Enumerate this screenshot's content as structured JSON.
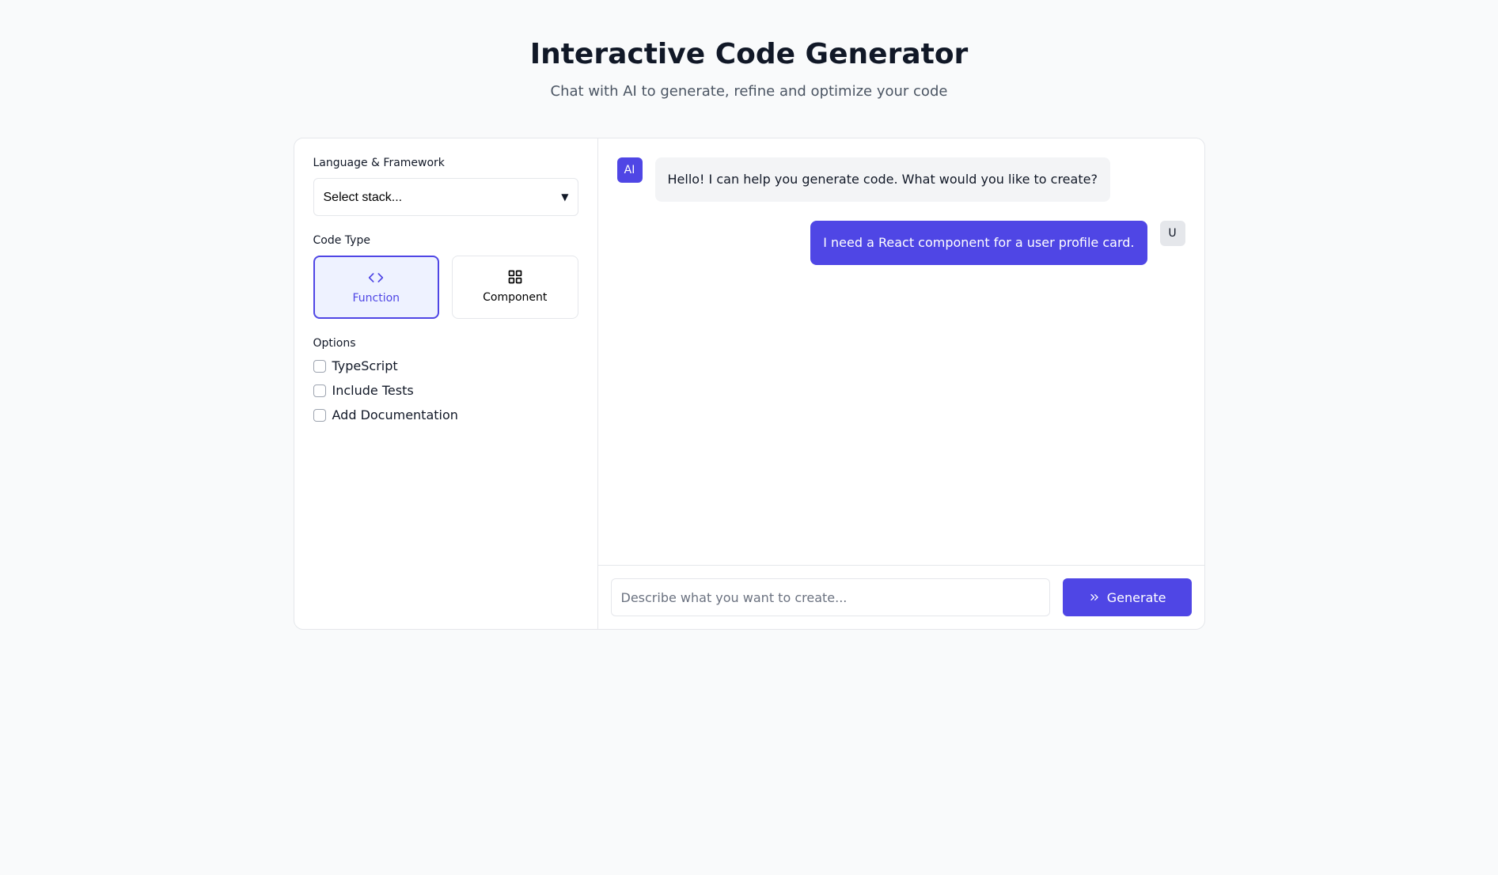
{
  "header": {
    "title": "Interactive Code Generator",
    "subtitle": "Chat with AI to generate, refine and optimize your code"
  },
  "sidebar": {
    "language_label": "Language & Framework",
    "select_placeholder": "Select stack...",
    "code_type_label": "Code Type",
    "types": [
      {
        "label": "Function",
        "icon": "code-icon",
        "active": true
      },
      {
        "label": "Component",
        "icon": "layout-icon",
        "active": false
      }
    ],
    "options_label": "Options",
    "options": [
      {
        "label": "TypeScript",
        "checked": false
      },
      {
        "label": "Include Tests",
        "checked": false
      },
      {
        "label": "Add Documentation",
        "checked": false
      }
    ]
  },
  "chat": {
    "messages": [
      {
        "role": "ai",
        "avatar": "AI",
        "text": "Hello! I can help you generate code. What would you like to create?"
      },
      {
        "role": "user",
        "avatar": "U",
        "text": "I need a React component for a user profile card."
      }
    ],
    "input_placeholder": "Describe what you want to create...",
    "generate_label": "Generate"
  }
}
